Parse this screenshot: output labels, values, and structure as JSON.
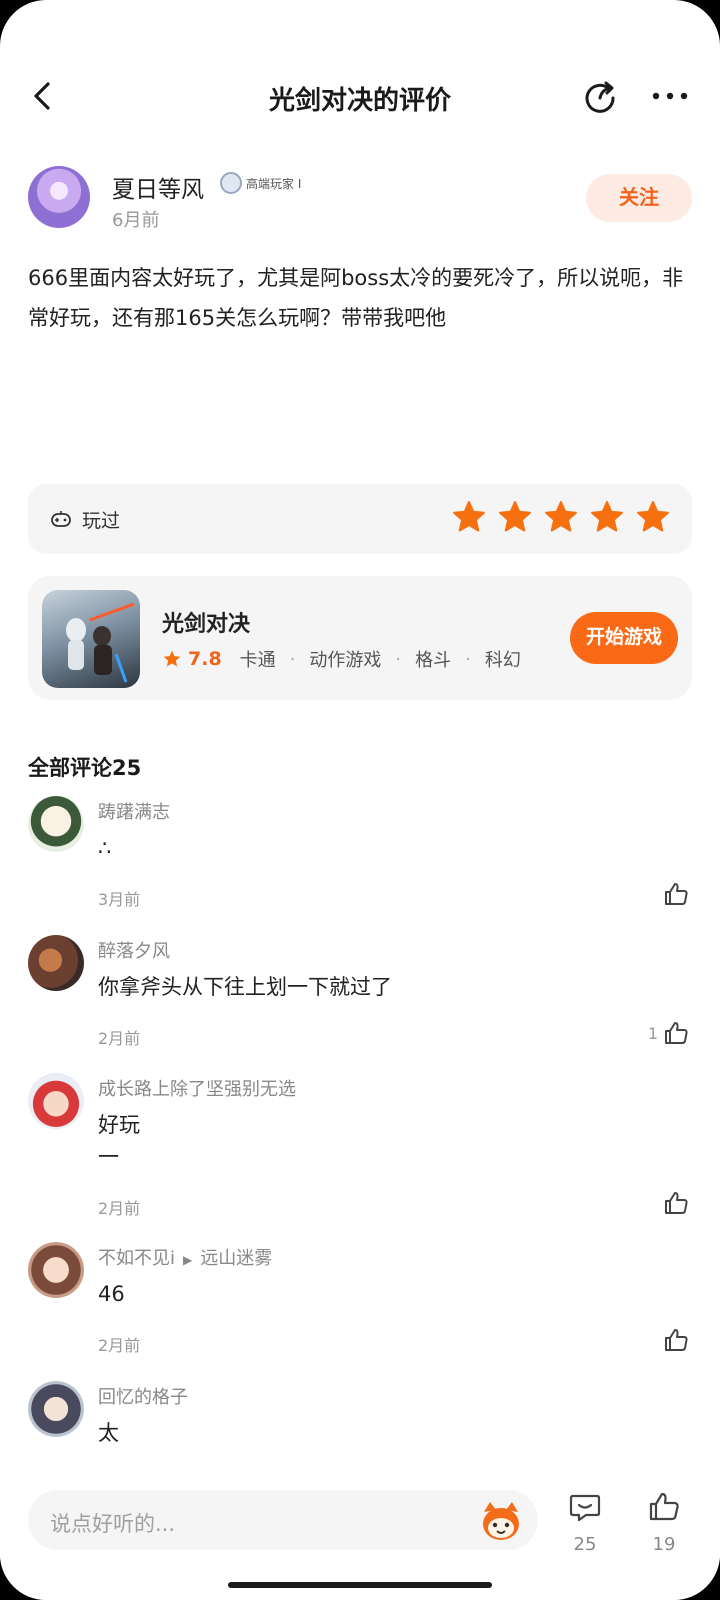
{
  "header": {
    "title": "光剑对决的评价"
  },
  "author": {
    "name": "夏日等风",
    "badge": "高端玩家 I",
    "time": "6月前",
    "follow_label": "关注"
  },
  "review": {
    "text": "666里面内容太好玩了，尤其是阿boss太冷的要死冷了，所以说呃，非常好玩，还有那165关怎么玩啊？带带我吧他"
  },
  "played": {
    "label": "玩过",
    "stars": 5,
    "star_color": "#f7700f"
  },
  "game": {
    "name": "光剑对决",
    "rating": "7.8",
    "tags": [
      "卡通",
      "动作游戏",
      "格斗",
      "科幻"
    ],
    "play_label": "开始游戏"
  },
  "comments_section": {
    "title": "全部评论25"
  },
  "comments": [
    {
      "name": "踌躇满志",
      "text": "∴",
      "time": "3月前",
      "likes": ""
    },
    {
      "name": "醉落夕风",
      "text": "你拿斧头从下往上划一下就过了",
      "time": "2月前",
      "likes": "1"
    },
    {
      "name": "成长路上除了坚强别无选",
      "text": "好玩\n一",
      "time": "2月前",
      "likes": ""
    },
    {
      "name": "不如不见i",
      "reply_to": "远山迷雾",
      "text": "46",
      "time": "2月前",
      "likes": ""
    },
    {
      "name": "回忆的格子",
      "text": "太",
      "time": "",
      "likes": ""
    }
  ],
  "bottom": {
    "input_placeholder": "说点好听的...",
    "comment_count": "25",
    "like_count": "19"
  },
  "colors": {
    "accent": "#fa6a16",
    "follow_bg": "#fdeae3"
  }
}
